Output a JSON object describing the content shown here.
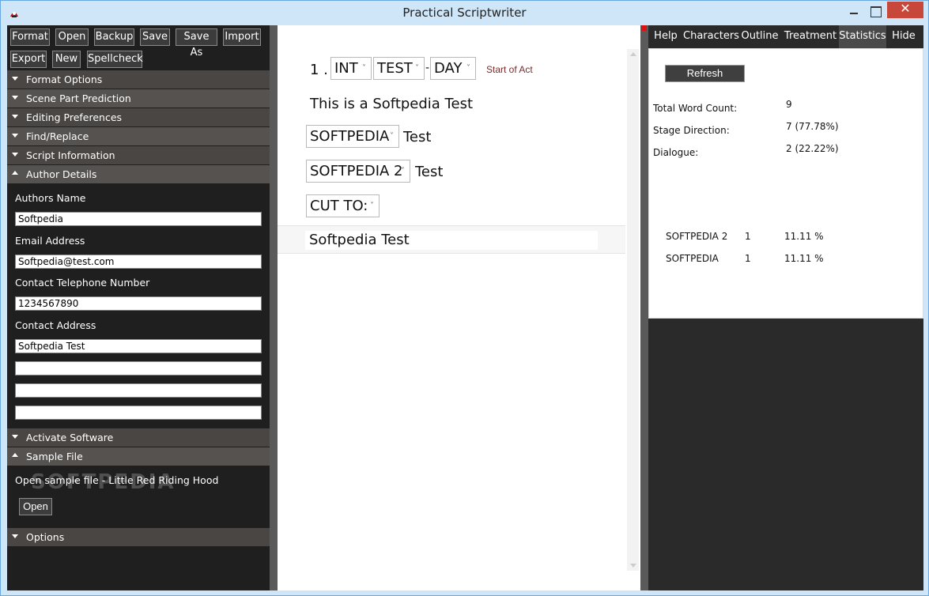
{
  "window": {
    "title": "Practical Scriptwriter",
    "close_glyph": "✕"
  },
  "toolbar": {
    "format": "Format",
    "open": "Open",
    "backup": "Backup",
    "save": "Save",
    "save_as": "Save As",
    "import": "Import",
    "export": "Export",
    "new": "New",
    "spellcheck": "Spellcheck"
  },
  "sections": {
    "format_options": "Format Options",
    "scene_part_prediction": "Scene Part Prediction",
    "editing_preferences": "Editing Preferences",
    "find_replace": "Find/Replace",
    "script_information": "Script Information",
    "author_details": "Author Details",
    "activate_software": "Activate Software",
    "sample_file": "Sample File",
    "options": "Options"
  },
  "author": {
    "name_label": "Authors Name",
    "name_value": "Softpedia",
    "email_label": "Email Address",
    "email_value": "Softpedia@test.com",
    "phone_label": "Contact Telephone Number",
    "phone_value": "1234567890",
    "address_label": "Contact Address",
    "address_line1": "Softpedia Test",
    "address_line2": "",
    "address_line3": "",
    "address_line4": ""
  },
  "sample": {
    "text": "Open sample file - Little Red Riding Hood",
    "open_button": "Open",
    "watermark": "SOFTPEDIA"
  },
  "editor": {
    "scene_number": "1 .",
    "scene_int": "INT",
    "scene_location": "TEST",
    "scene_dash": "-",
    "scene_time": "DAY",
    "start_of_act": "Start of Act",
    "action_text": "This is a Softpedia Test",
    "character1": "SOFTPEDIA",
    "dialogue1": "Test",
    "character2": "SOFTPEDIA 2",
    "dialogue2": "Test",
    "transition": "CUT TO:",
    "current_line": "Softpedia Test"
  },
  "right_tabs": {
    "help": "Help",
    "characters": "Characters",
    "outline": "Outline",
    "treatment": "Treatment",
    "statistics": "Statistics",
    "hide": "Hide"
  },
  "stats": {
    "refresh": "Refresh",
    "total_label": "Total Word Count:",
    "total_value": "9",
    "stage_label": "Stage Direction:",
    "stage_value": "7 (77.78%)",
    "dialogue_label": "Dialogue:",
    "dialogue_value": "2 (22.22%)",
    "characters": [
      {
        "name": "SOFTPEDIA 2",
        "count": "1",
        "percent": "11.11 %"
      },
      {
        "name": "SOFTPEDIA",
        "count": "1",
        "percent": "11.11 %"
      }
    ]
  },
  "colors": {
    "panel_dark": "#1f1f1f",
    "section_header": "#4a4644",
    "accent_act": "#7a2a2a",
    "close_red": "#c7473a"
  }
}
